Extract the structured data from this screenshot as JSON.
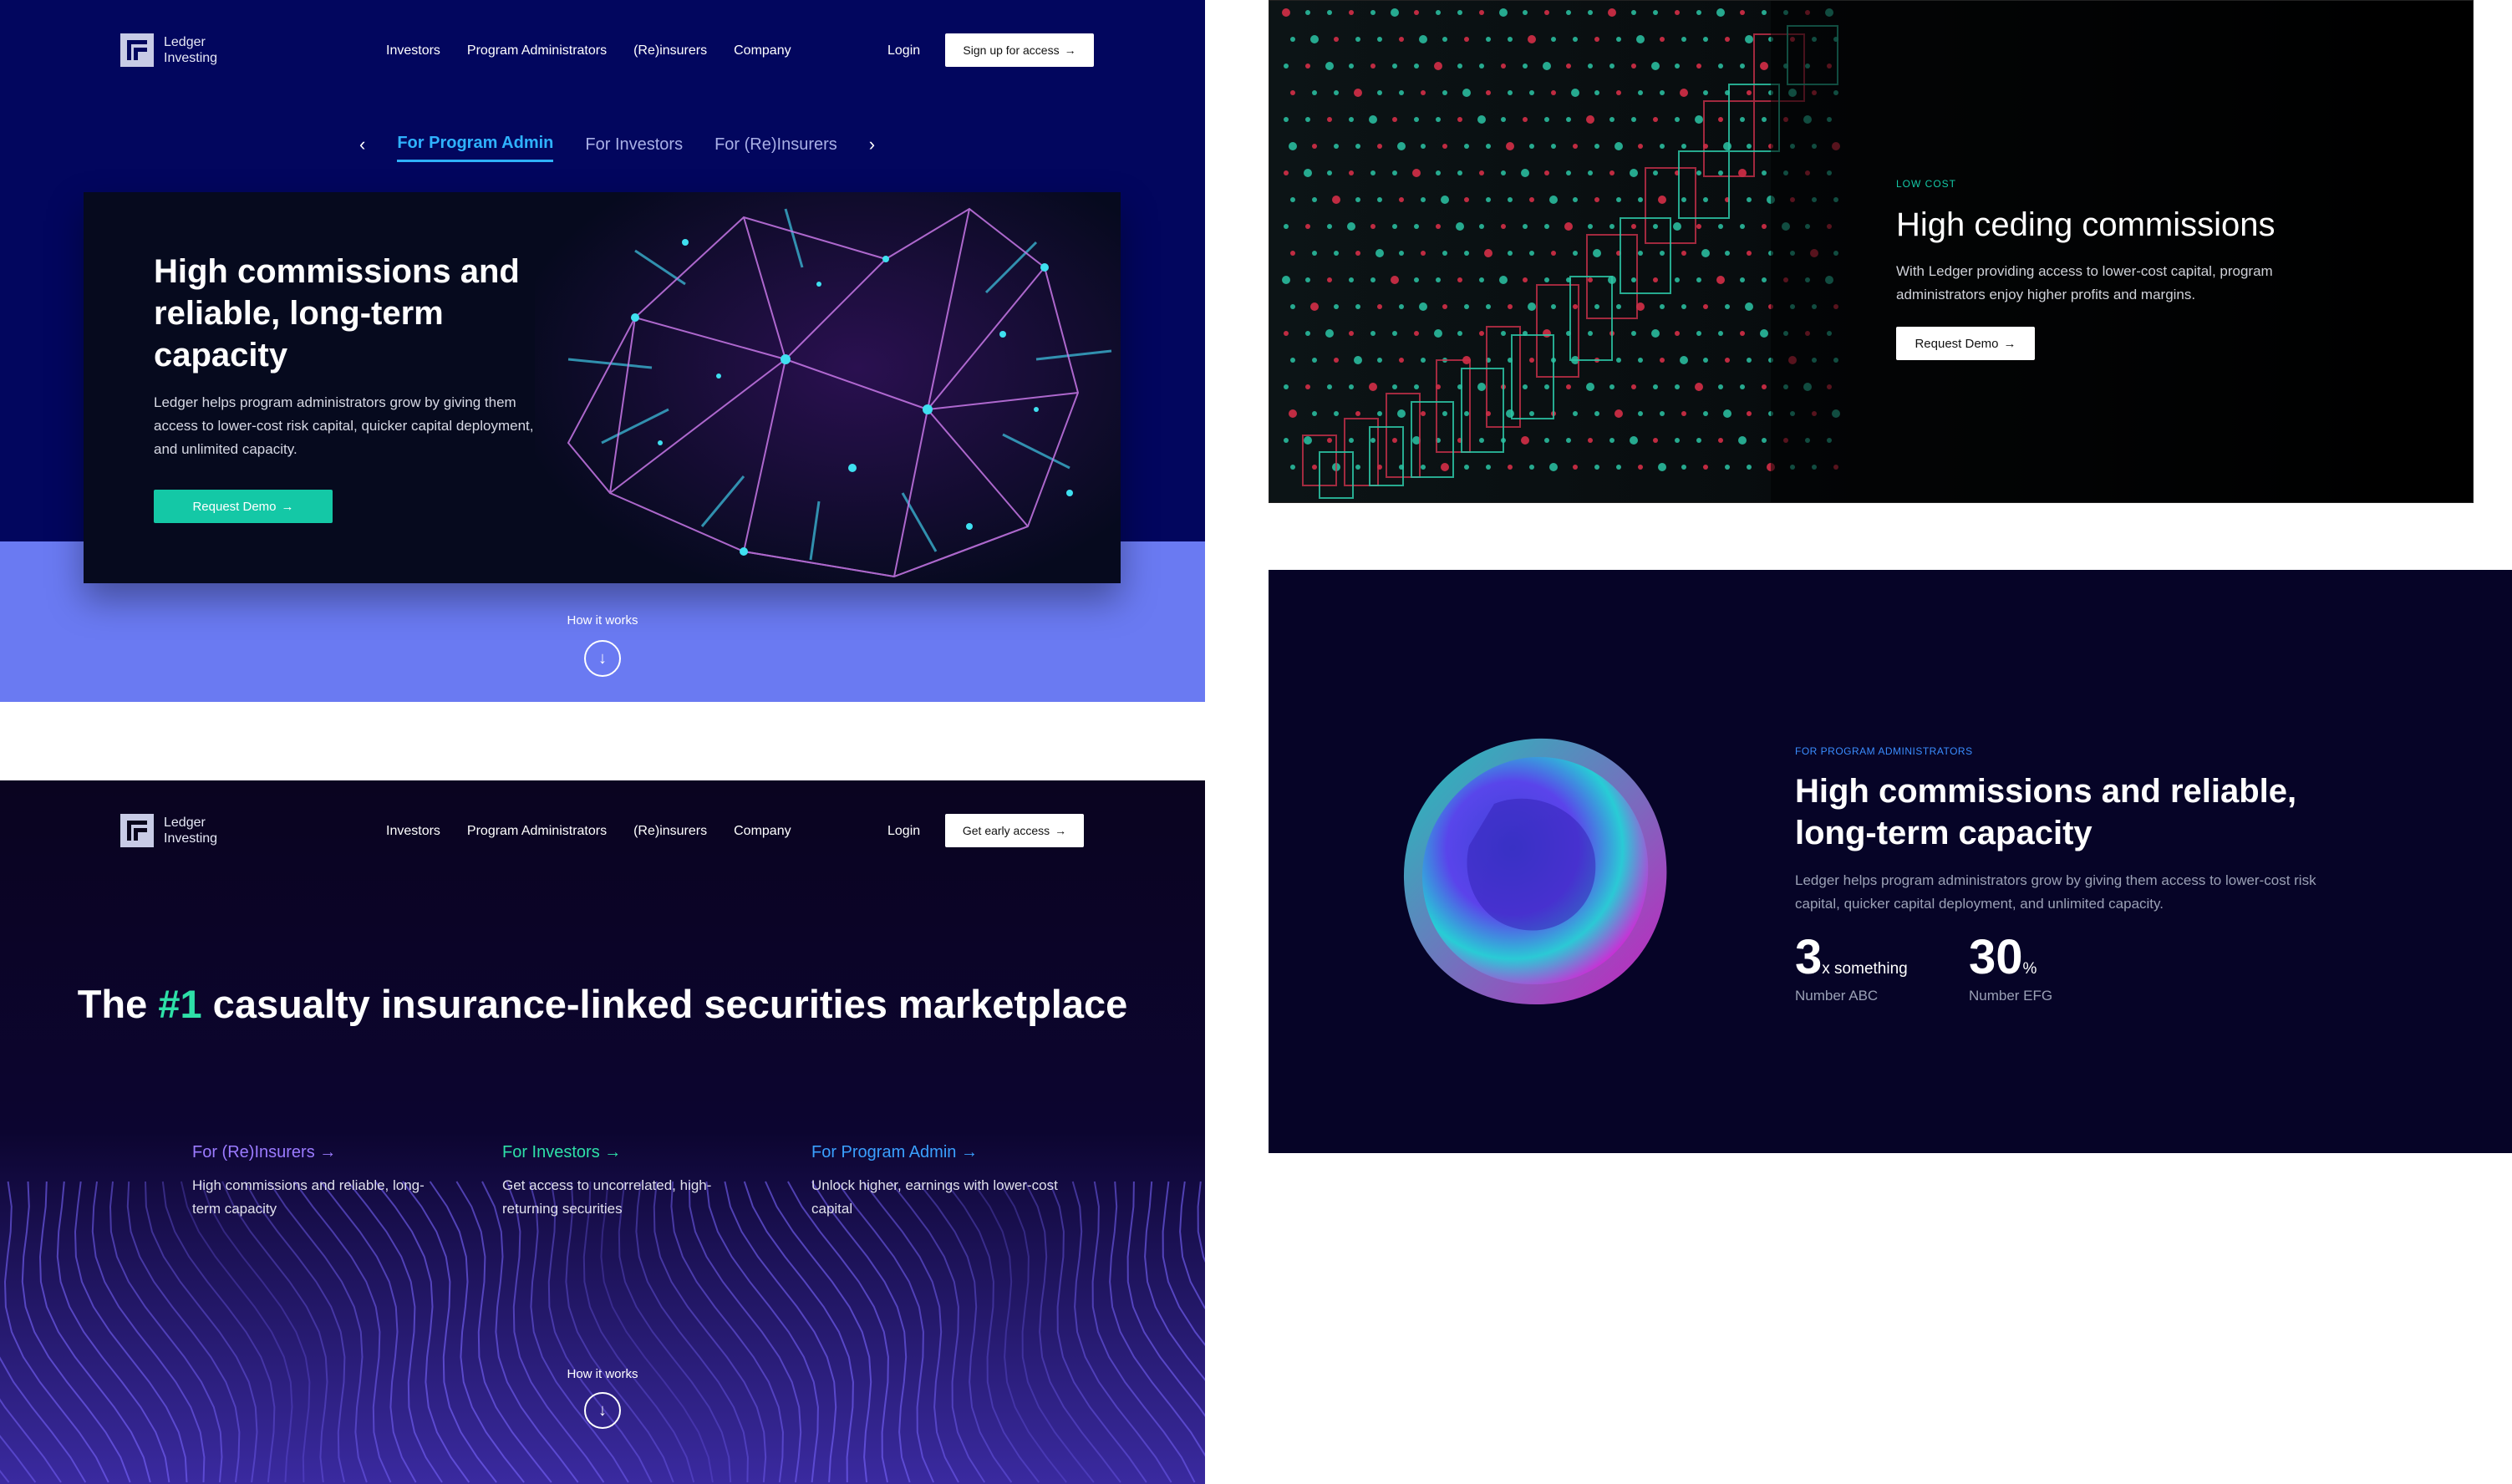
{
  "brand": {
    "line1": "Ledger",
    "line2": "Investing"
  },
  "nav": {
    "items": [
      "Investors",
      "Program Administrators",
      "(Re)insurers",
      "Company"
    ],
    "login": "Login"
  },
  "panel_a": {
    "cta": "Sign up for access",
    "tabs": [
      "For Program Admin",
      "For Investors",
      "For (Re)Insurers"
    ],
    "active_tab": 0,
    "hero_title": "High commissions and reliable, long-term capacity",
    "hero_body": "Ledger helps program administrators grow by giving them access to lower-cost risk capital, quicker capital deployment, and unlimited capacity.",
    "button": "Request Demo",
    "how": "How it works"
  },
  "panel_b": {
    "eyebrow": "LOW COST",
    "title": "High ceding commissions",
    "body": "With Ledger providing access to lower-cost capital, program administrators enjoy higher profits and margins.",
    "button": "Request Demo"
  },
  "panel_c": {
    "cta": "Get early access",
    "title_pre": "The ",
    "title_highlight": "#1",
    "title_post": " casualty insurance-linked securities marketplace",
    "columns": [
      {
        "title": "For (Re)Insurers",
        "desc": "High commissions and reliable, long-term capacity",
        "color": "#9b7bff"
      },
      {
        "title": "For Investors",
        "desc": "Get access to uncorrelated, high-returning securities",
        "color": "#2ee0a8"
      },
      {
        "title": "For Program Admin",
        "desc": "Unlock higher, earnings with lower-cost capital",
        "color": "#3aa0ff"
      }
    ],
    "how": "How it works"
  },
  "panel_d": {
    "eyebrow": "FOR PROGRAM ADMINISTRATORS",
    "title": "High commissions and reliable, long-term capacity",
    "body": "Ledger helps program administrators grow by giving them access to lower-cost risk capital, quicker capital deployment, and unlimited capacity.",
    "stats": [
      {
        "value": "3",
        "suffix": "x something",
        "label": "Number ABC"
      },
      {
        "value": "30",
        "suffix": "%",
        "label": "Number EFG"
      }
    ]
  },
  "icons": {
    "arrow": "→",
    "prev": "‹",
    "next": "›",
    "down": "↓"
  },
  "colors": {
    "navy": "#02065e",
    "periwinkle": "#6a7af2",
    "teal": "#14c8a6",
    "blue_accent": "#2fb2ff",
    "green_accent": "#2ee0a8",
    "dark": "#08041c"
  }
}
